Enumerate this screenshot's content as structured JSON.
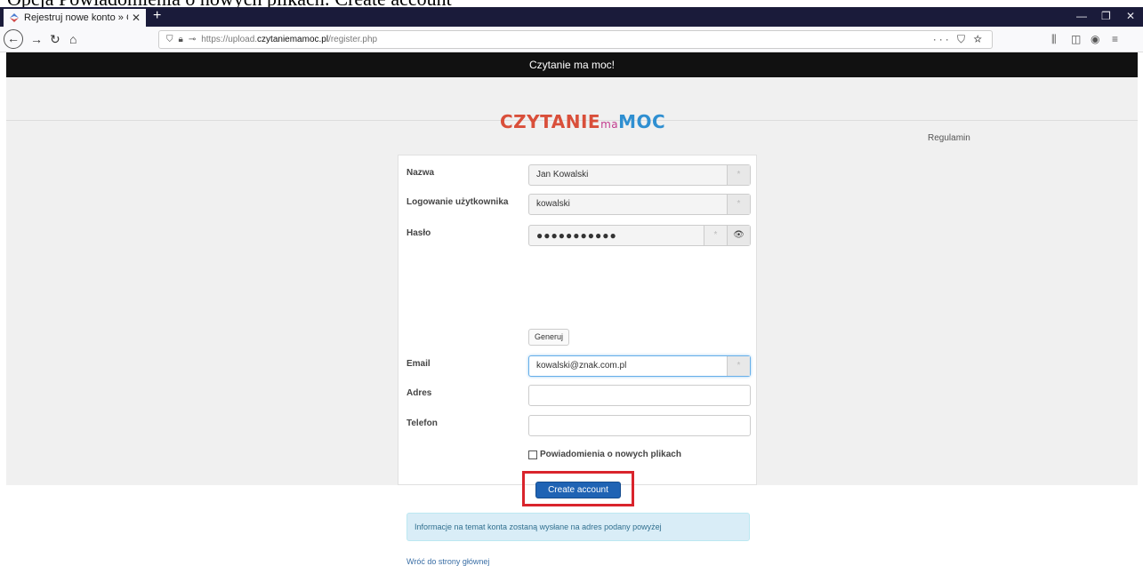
{
  "caption": "Opcja Powiadomienia o nowych plikach: Create account",
  "browser": {
    "tab_title": "Rejestruj nowe konto » Czytanie",
    "tab_close": "✕",
    "new_tab": "+",
    "url_prefix": "https://upload.",
    "url_domain": "czytaniemamoc.pl",
    "url_path": "/register.php",
    "win_min": "—",
    "win_max": "❐",
    "win_close": "✕"
  },
  "site": {
    "header": "Czytanie ma moc!",
    "logo": {
      "part1": "CZYTANIE",
      "part2": "ma",
      "part3": "MOC"
    },
    "rules_link": "Regulamin"
  },
  "form": {
    "name_label": "Nazwa",
    "name_value": "Jan Kowalski",
    "login_label": "Logowanie użytkownika",
    "login_value": "kowalski",
    "password_label": "Hasło",
    "password_value": "●●●●●●●●●●●",
    "generate_label": "Generuj",
    "email_label": "Email",
    "email_value": "kowalski@znak.com.pl",
    "address_label": "Adres",
    "address_value": "",
    "phone_label": "Telefon",
    "phone_value": "",
    "required_mark": "*",
    "notify_label": "Powiadomienia o nowych plikach",
    "create_label": "Create account",
    "info_text": "Informacje na temat konta zostaną wysłane na adres podany powyżej",
    "back_link": "Wróć do strony głównej"
  }
}
